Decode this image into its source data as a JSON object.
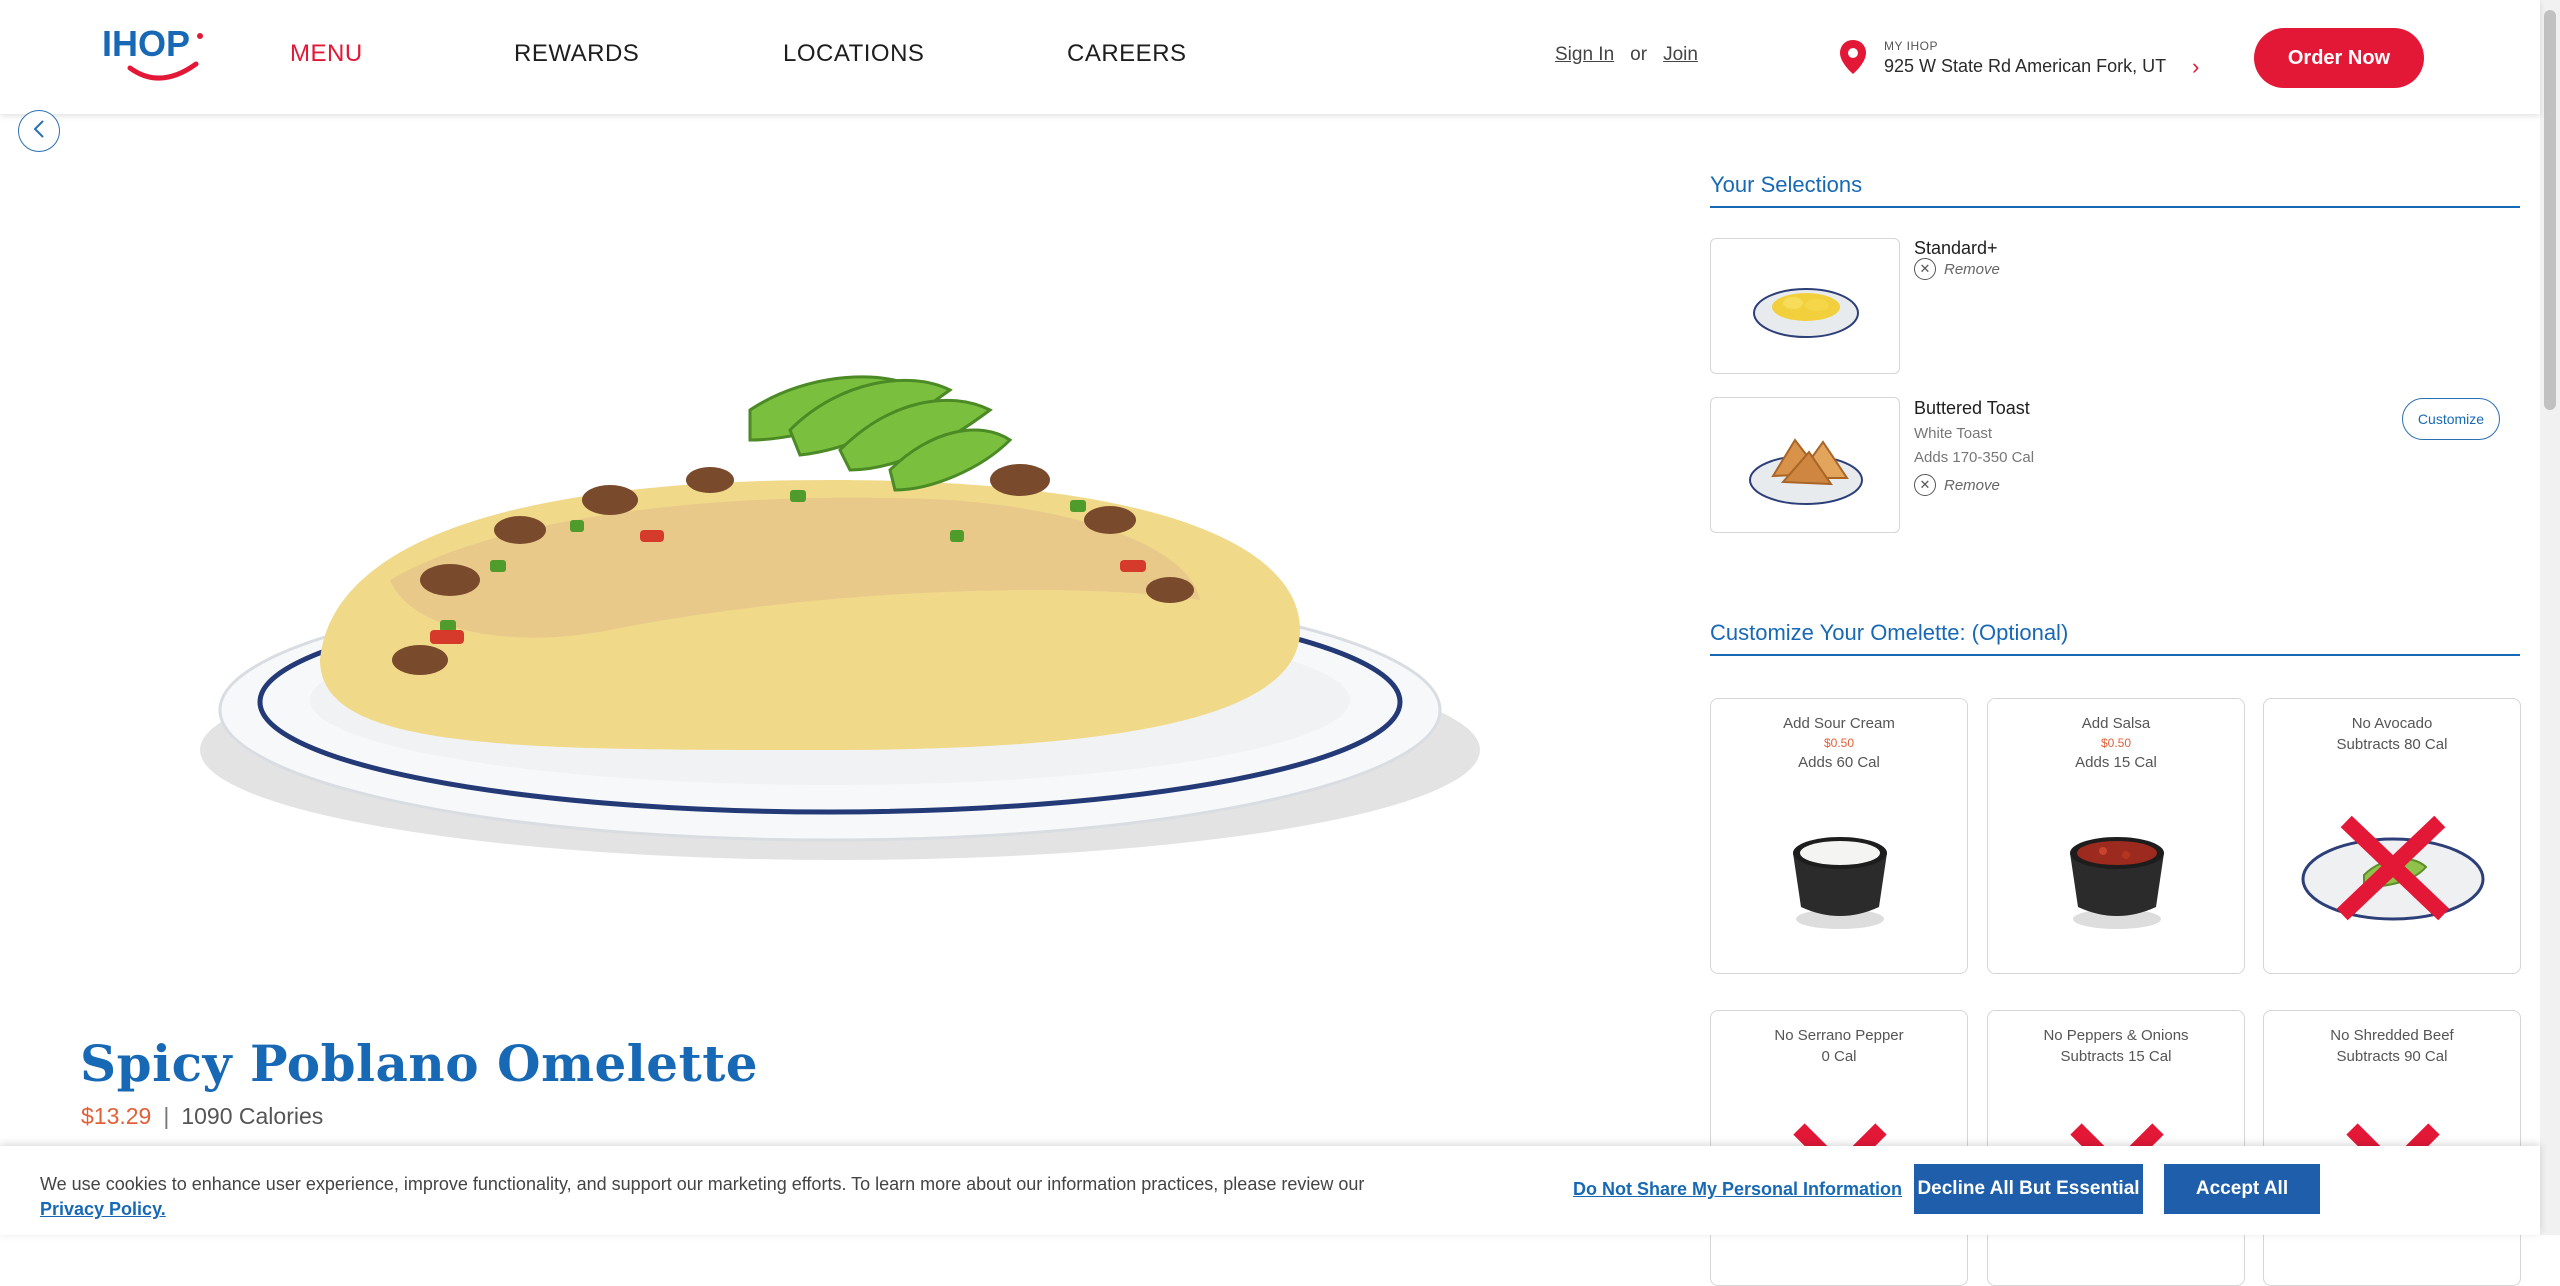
{
  "header": {
    "logo_text": "IHOP",
    "nav": [
      "MENU",
      "REWARDS",
      "LOCATIONS",
      "CAREERS"
    ],
    "sign_in": "Sign In",
    "or": "or",
    "join": "Join",
    "location_label": "MY IHOP",
    "location_address": "925 W State Rd American Fork, UT",
    "order_button": "Order Now"
  },
  "product": {
    "title": "Spicy Poblano Omelette",
    "price": "$13.29",
    "separator": "|",
    "calories": "1090 Calories"
  },
  "selections": {
    "heading": "Your Selections",
    "items": [
      {
        "name": "Standard+",
        "sub1": "",
        "sub2": "",
        "remove": "Remove"
      },
      {
        "name": "Buttered Toast",
        "sub1": "White Toast",
        "sub2": "Adds 170-350 Cal",
        "remove": "Remove",
        "customize": "Customize"
      }
    ]
  },
  "customize": {
    "heading": "Customize Your Omelette: (Optional)",
    "options": [
      {
        "name": "Add Sour Cream",
        "price": "$0.50",
        "cal": "Adds 60 Cal"
      },
      {
        "name": "Add Salsa",
        "price": "$0.50",
        "cal": "Adds 15 Cal"
      },
      {
        "name": "No Avocado",
        "price": "",
        "cal": "Subtracts 80 Cal"
      },
      {
        "name": "No Serrano Pepper",
        "price": "",
        "cal": "0 Cal"
      },
      {
        "name": "No Peppers & Onions",
        "price": "",
        "cal": "Subtracts 15 Cal"
      },
      {
        "name": "No Shredded Beef",
        "price": "",
        "cal": "Subtracts 90 Cal"
      }
    ]
  },
  "cookie": {
    "message": "We use cookies to enhance user experience, improve functionality, and support our marketing efforts. To learn more about our information practices, please review our",
    "privacy_link": "Privacy Policy.",
    "dns": "Do Not Share My Personal Information",
    "decline": "Decline All But Essential",
    "accept": "Accept All"
  },
  "colors": {
    "brand_blue": "#1869b5",
    "brand_red": "#e31837",
    "price_orange": "#e0603a"
  }
}
